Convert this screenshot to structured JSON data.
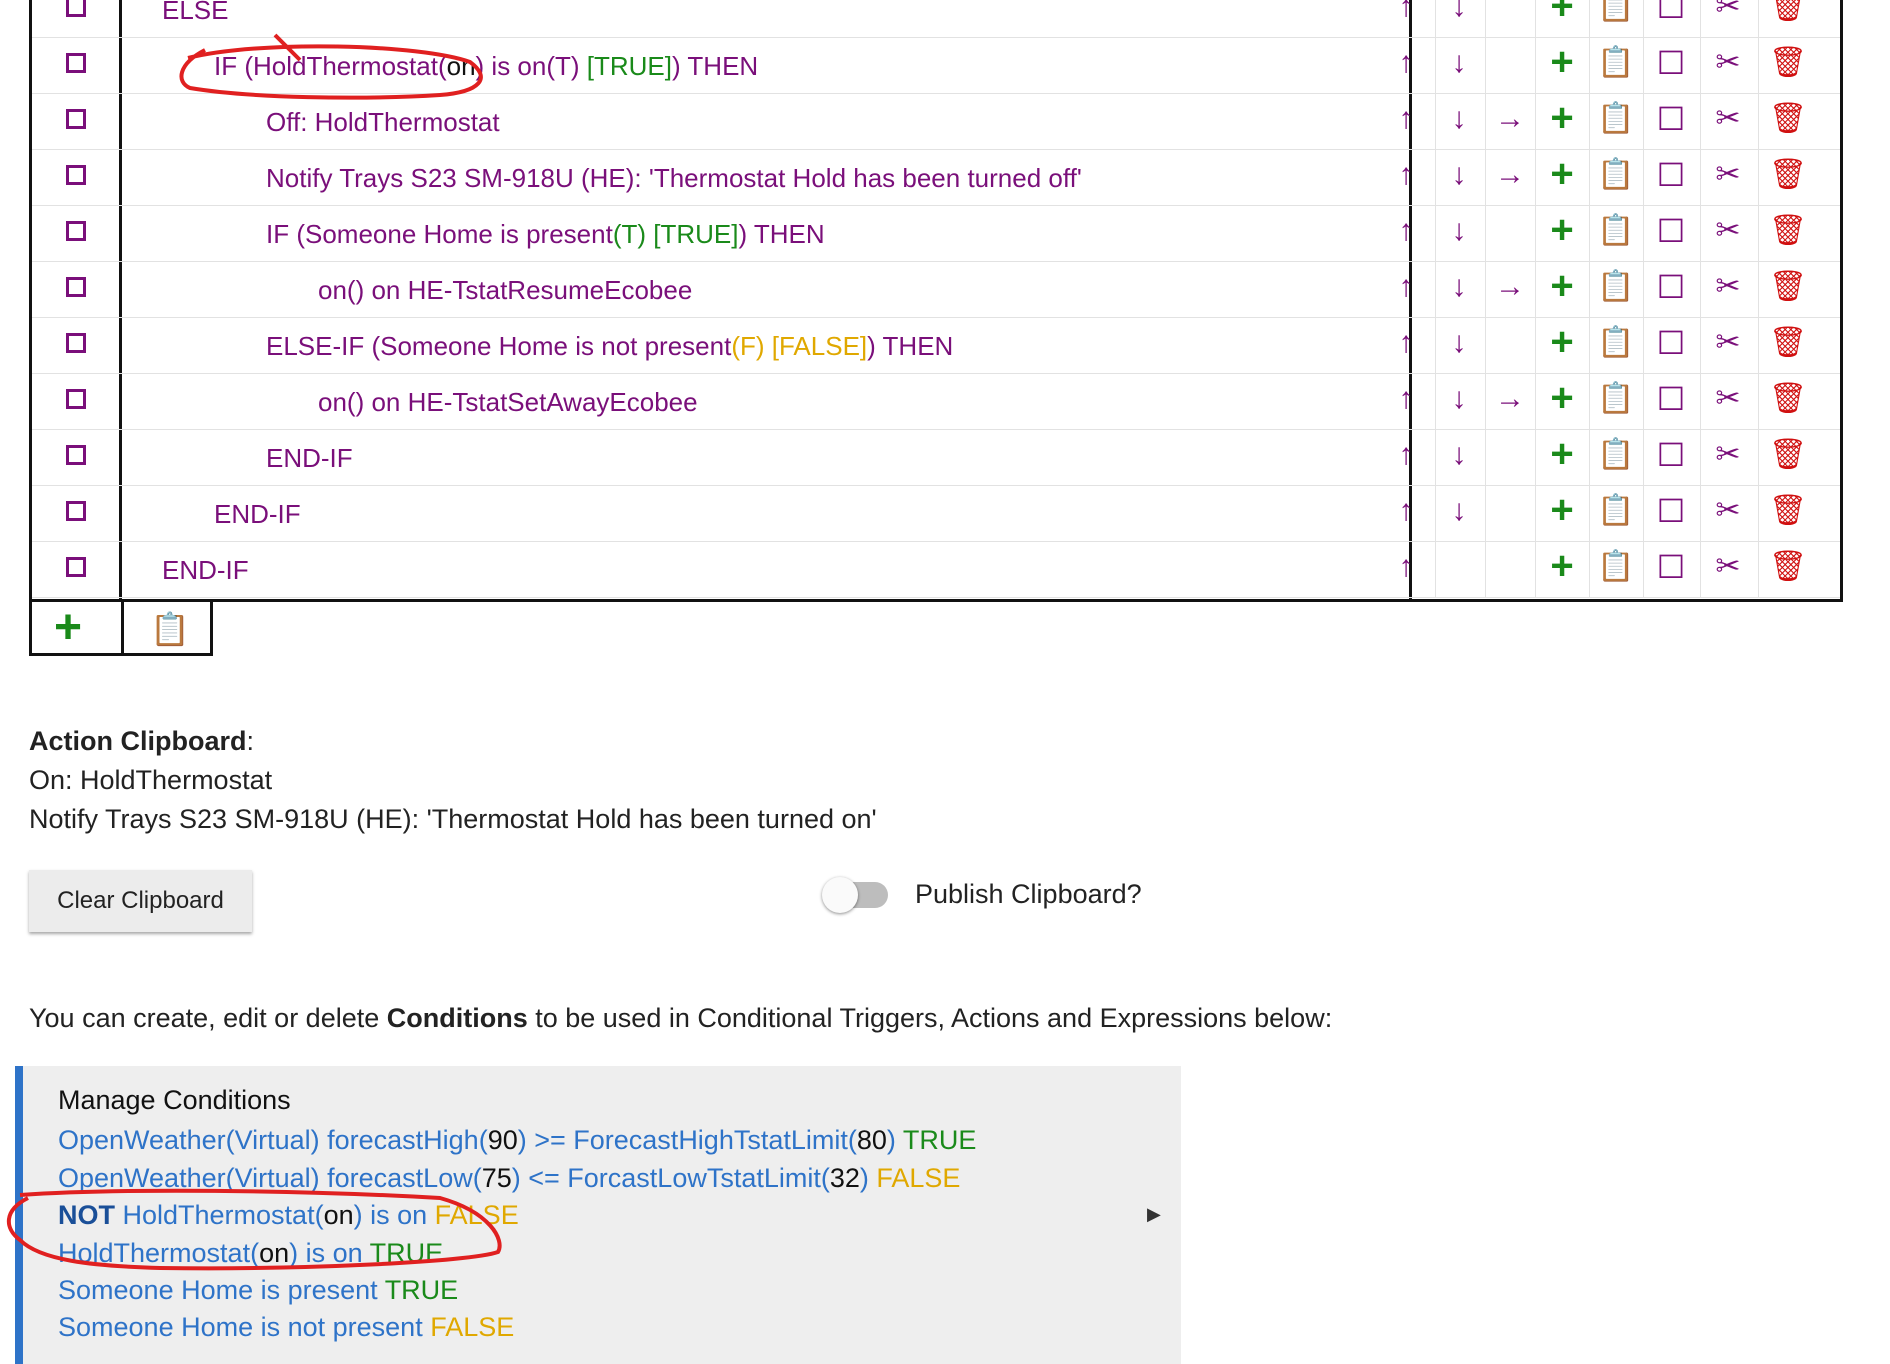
{
  "action_table": {
    "rows": [
      {
        "indent": 0,
        "tokens": [
          {
            "t": "ELSE",
            "c": "purple"
          }
        ],
        "controls": [
          "up",
          "down",
          "",
          "plus",
          "paste",
          "square",
          "cut",
          "trash"
        ]
      },
      {
        "indent": 1,
        "tokens": [
          {
            "t": "IF (HoldThermostat(",
            "c": "purple"
          },
          {
            "t": "on",
            "c": "black"
          },
          {
            "t": ") is on(T) ",
            "c": "purple"
          },
          {
            "t": "[TRUE]",
            "c": "green"
          },
          {
            "t": ") THEN",
            "c": "purple"
          }
        ],
        "controls": [
          "up",
          "down",
          "",
          "plus",
          "paste",
          "square",
          "cut",
          "trash"
        ]
      },
      {
        "indent": 2,
        "tokens": [
          {
            "t": "Off: HoldThermostat",
            "c": "purple"
          }
        ],
        "controls": [
          "up",
          "down",
          "right",
          "plus",
          "paste",
          "square",
          "cut",
          "trash"
        ]
      },
      {
        "indent": 2,
        "tokens": [
          {
            "t": "Notify Trays S23 SM-918U (HE): 'Thermostat Hold has been turned off'",
            "c": "purple"
          }
        ],
        "controls": [
          "up",
          "down",
          "right",
          "plus",
          "paste",
          "square",
          "cut",
          "trash"
        ]
      },
      {
        "indent": 2,
        "tokens": [
          {
            "t": "IF (Someone Home is present",
            "c": "purple"
          },
          {
            "t": "(T) [TRUE]",
            "c": "green"
          },
          {
            "t": ") THEN",
            "c": "purple"
          }
        ],
        "controls": [
          "up",
          "down",
          "",
          "plus",
          "paste",
          "square",
          "cut",
          "trash"
        ]
      },
      {
        "indent": 3,
        "tokens": [
          {
            "t": "on() on HE-TstatResumeEcobee",
            "c": "purple"
          }
        ],
        "controls": [
          "up",
          "down",
          "right",
          "plus",
          "paste",
          "square",
          "cut",
          "trash"
        ]
      },
      {
        "indent": 2,
        "tokens": [
          {
            "t": "ELSE-IF (Someone Home is not present",
            "c": "purple"
          },
          {
            "t": "(F) [FALSE]",
            "c": "yellow"
          },
          {
            "t": ") THEN",
            "c": "purple"
          }
        ],
        "controls": [
          "up",
          "down",
          "",
          "plus",
          "paste",
          "square",
          "cut",
          "trash"
        ]
      },
      {
        "indent": 3,
        "tokens": [
          {
            "t": "on() on HE-TstatSetAwayEcobee",
            "c": "purple"
          }
        ],
        "controls": [
          "up",
          "down",
          "right",
          "plus",
          "paste",
          "square",
          "cut",
          "trash"
        ]
      },
      {
        "indent": 2,
        "tokens": [
          {
            "t": "END-IF",
            "c": "purple"
          }
        ],
        "controls": [
          "up",
          "down",
          "",
          "plus",
          "paste",
          "square",
          "cut",
          "trash"
        ]
      },
      {
        "indent": 1,
        "tokens": [
          {
            "t": "END-IF",
            "c": "purple"
          }
        ],
        "controls": [
          "up",
          "down",
          "",
          "plus",
          "paste",
          "square",
          "cut",
          "trash"
        ]
      },
      {
        "indent": 0,
        "tokens": [
          {
            "t": "END-IF",
            "c": "purple"
          }
        ],
        "controls": [
          "up",
          "",
          "",
          "plus",
          "paste",
          "square",
          "cut",
          "trash"
        ]
      }
    ],
    "icons": {
      "up": "↑",
      "down": "↓",
      "right": "→",
      "plus": "+",
      "paste": "📋",
      "square": "☐",
      "cut": "✂",
      "trash": "🗑"
    },
    "colors": {
      "purple": "#7a0f7a",
      "green": "#1a8a1a",
      "yellow": "#e0a800",
      "red": "#d01010"
    }
  },
  "add_row": {
    "plus_icon": "plus-icon",
    "paste_icon": "paste-icon"
  },
  "clipboard": {
    "title": "Action Clipboard",
    "colon": ":",
    "lines": [
      "On: HoldThermostat",
      "Notify Trays S23 SM-918U (HE): 'Thermostat Hold has been turned on'"
    ],
    "clear_button": "Clear Clipboard",
    "publish_label": "Publish Clipboard?",
    "publish_enabled": false
  },
  "conditions_intro": {
    "before": "You can create, edit or delete ",
    "bold": "Conditions",
    "after": " to be used in Conditional Triggers, Actions and Expressions below:"
  },
  "conditions": {
    "header": "Manage Conditions",
    "accent": "#2e73c8",
    "items": [
      [
        {
          "t": "OpenWeather(Virtual) forecastHigh(",
          "c": "blue"
        },
        {
          "t": "90",
          "c": "black"
        },
        {
          "t": ") >= ForecastHighTstatLimit(",
          "c": "blue"
        },
        {
          "t": "80",
          "c": "black"
        },
        {
          "t": ") ",
          "c": "blue"
        },
        {
          "t": "TRUE",
          "c": "green"
        }
      ],
      [
        {
          "t": "OpenWeather(Virtual) forecastLow(",
          "c": "blue"
        },
        {
          "t": "75",
          "c": "black"
        },
        {
          "t": ") <= ForcastLowTstatLimit(",
          "c": "blue"
        },
        {
          "t": "32",
          "c": "black"
        },
        {
          "t": ") ",
          "c": "blue"
        },
        {
          "t": "FALSE",
          "c": "yellow"
        }
      ],
      [
        {
          "t": "NOT",
          "c": "bold"
        },
        {
          "t": " HoldThermostat(",
          "c": "blue"
        },
        {
          "t": "on",
          "c": "black"
        },
        {
          "t": ") is on ",
          "c": "blue"
        },
        {
          "t": "FALSE",
          "c": "yellow"
        }
      ],
      [
        {
          "t": "HoldThermostat(",
          "c": "blue"
        },
        {
          "t": "on",
          "c": "black"
        },
        {
          "t": ") is on ",
          "c": "blue"
        },
        {
          "t": "TRUE",
          "c": "green"
        }
      ],
      [
        {
          "t": "Someone Home is present ",
          "c": "blue"
        },
        {
          "t": "TRUE",
          "c": "green"
        }
      ],
      [
        {
          "t": "Someone Home is not present ",
          "c": "blue"
        },
        {
          "t": "FALSE",
          "c": "yellow"
        }
      ]
    ],
    "expand_icon": "▶"
  }
}
